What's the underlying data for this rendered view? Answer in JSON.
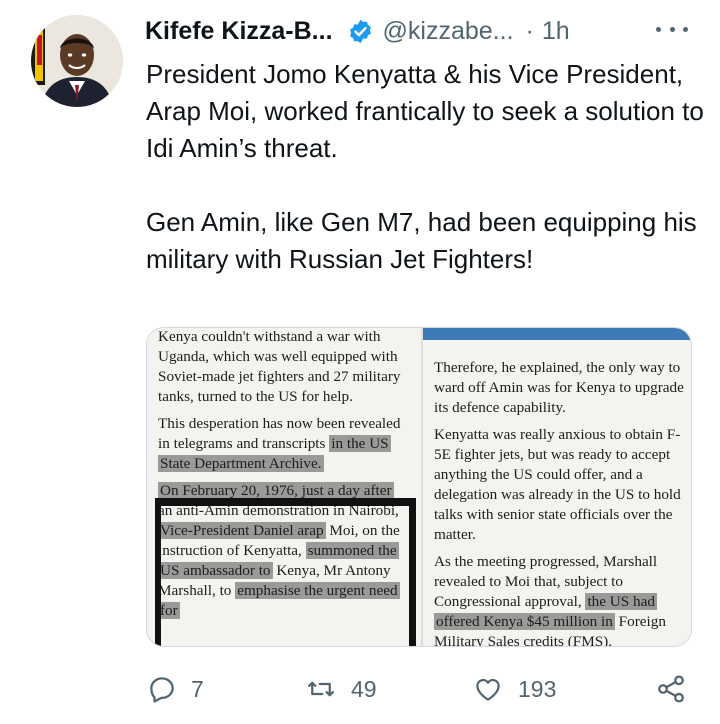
{
  "author": {
    "name": "Kifefe Kizza-B...",
    "handle": "@kizzabe...",
    "separator": "·",
    "time": "1h"
  },
  "tweet": {
    "paragraphs": [
      "President Jomo Kenyatta & his Vice President, Arap Moi, worked frantically to seek a solution to Idi Amin’s threat.",
      "Gen Amin, like Gen M7, had been equipping his military with Russian Jet Fighters!"
    ]
  },
  "clipping": {
    "left": {
      "p1": "Kenya couldn't withstand a war with Uganda, which was well equipped with Soviet-made jet fighters and 27 military tanks, turned to the US for help.",
      "p2a": "This desperation has now been revealed in telegrams and transcripts ",
      "p2_hl": "in the US State Department Archive.",
      "p3_hl1": "On February 20, 1976, just a day after",
      "p3a": " an anti-Amin demonstration in Nairobi, ",
      "p3_hl2": "Vice-President Daniel arap",
      "p3b": " Moi, on the instruction of Kenyatta, ",
      "p3_hl3": "summoned the US ambassador to",
      "p3c": " Kenya, Mr Antony Marshall, to ",
      "p3_hl4": "emphasise the urgent need for"
    },
    "right": {
      "p1": "Therefore, he explained, the only way to ward off Amin was for Kenya to upgrade its defence capability.",
      "p2": "Kenyatta was really anxious to obtain F-5E fighter jets, but was ready to accept anything the US could offer, and a delegation was already in the US to hold talks with senior state officials over the matter.",
      "p3a": "As the meeting progressed, Marshall revealed to Moi that, subject to Congressional approval, ",
      "p3_hl": "the US had offered Kenya $45 million in",
      "p3b": " Foreign Military Sales credits (FMS)."
    }
  },
  "actions": {
    "replies": "7",
    "retweets": "49",
    "likes": "193"
  },
  "colors": {
    "verified": "#1d9bf0",
    "secondary_text": "#536471",
    "clipping_band": "#3d7bb8"
  },
  "icons": [
    "verified-badge-icon",
    "more-icon",
    "reply-icon",
    "retweet-icon",
    "like-icon",
    "share-icon"
  ]
}
